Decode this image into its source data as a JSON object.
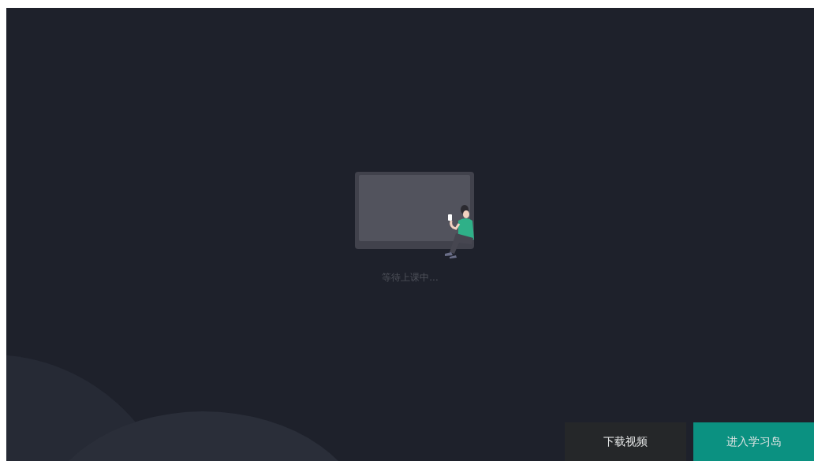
{
  "status_text": "等待上课中...",
  "buttons": [
    {
      "label": "下载视频",
      "kind": "secondary"
    },
    {
      "label": "进入学习岛",
      "kind": "primary"
    }
  ]
}
